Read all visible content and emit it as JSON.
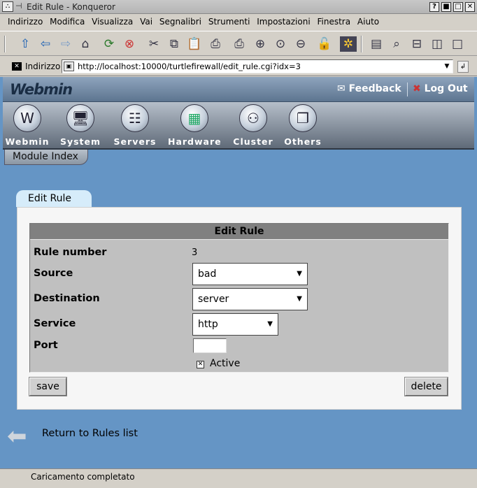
{
  "window": {
    "title": "Edit Rule - Konqueror",
    "controls": [
      "?",
      "■",
      "□",
      "✕"
    ]
  },
  "menu": [
    "Indirizzo",
    "Modifica",
    "Visualizza",
    "Vai",
    "Segnalibri",
    "Strumenti",
    "Impostazioni",
    "Finestra",
    "Aiuto"
  ],
  "toolbar_icons": [
    "up-arrow-icon",
    "back-arrow-icon",
    "forward-arrow-icon",
    "home-icon",
    "reload-icon",
    "stop-icon",
    "cut-icon",
    "copy-icon",
    "paste-icon",
    "print-icon",
    "print-preview-icon",
    "zoom-in-icon",
    "zoom-normal-icon",
    "zoom-out-icon",
    "security-lock-icon",
    "konqueror-gear-icon",
    "text-view-icon",
    "find-icon",
    "split-horizontal-icon",
    "split-vertical-icon",
    "blank-view-icon"
  ],
  "location": {
    "label": "Indirizzo",
    "url": "http://localhost:10000/turtlefirewall/edit_rule.cgi?idx=3"
  },
  "webmin": {
    "logo": "Webmin",
    "feedback": "Feedback",
    "logout": "Log Out",
    "categories": [
      {
        "label": "Webmin",
        "icon": "webmin-logo-icon"
      },
      {
        "label": "System",
        "icon": "system-monitor-icon"
      },
      {
        "label": "Servers",
        "icon": "servers-icon"
      },
      {
        "label": "Hardware",
        "icon": "hardware-board-icon"
      },
      {
        "label": "Cluster",
        "icon": "cluster-network-icon"
      },
      {
        "label": "Others",
        "icon": "others-windows-icon"
      }
    ],
    "module_index": "Module Index"
  },
  "tab": "Edit Rule",
  "form": {
    "header": "Edit Rule",
    "rule_number_label": "Rule number",
    "rule_number": "3",
    "source_label": "Source",
    "source_value": "bad",
    "destination_label": "Destination",
    "destination_value": "server",
    "service_label": "Service",
    "service_value": "http",
    "port_label": "Port",
    "port_value": "",
    "active_label": "Active",
    "active_checked": true,
    "save": "save",
    "delete": "delete"
  },
  "return_link": "Return to Rules list",
  "status": "Caricamento completato"
}
